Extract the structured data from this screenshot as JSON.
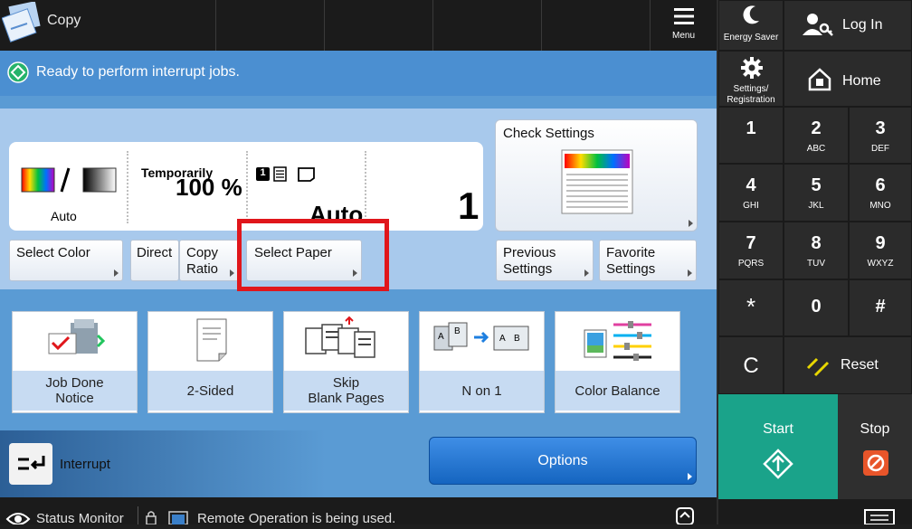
{
  "app": {
    "title": "Copy"
  },
  "header": {
    "menu_label": "Menu"
  },
  "status": {
    "message": "Ready to perform interrupt jobs."
  },
  "summary": {
    "color_mode": "Auto",
    "ratio_label": "Temporarily",
    "ratio_value": "100 %",
    "paper_value": "Auto",
    "copies": "1",
    "paper_indicator": "1"
  },
  "buttons": {
    "check_settings": "Check Settings",
    "select_color": "Select Color",
    "direct": "Direct",
    "copy_ratio_line1": "Copy",
    "copy_ratio_line2": "Ratio",
    "select_paper": "Select Paper",
    "previous_line1": "Previous",
    "previous_line2": "Settings",
    "favorite_line1": "Favorite",
    "favorite_line2": "Settings",
    "options": "Options",
    "interrupt": "Interrupt"
  },
  "features": [
    {
      "line1": "Job Done",
      "line2": "Notice"
    },
    {
      "line1": "2-Sided",
      "line2": ""
    },
    {
      "line1": "Skip",
      "line2": "Blank Pages"
    },
    {
      "line1": "N on 1",
      "line2": ""
    },
    {
      "line1": "Color Balance",
      "line2": ""
    }
  ],
  "right_panel": {
    "energy_saver": "Energy Saver",
    "log_in": "Log In",
    "settings_line1": "Settings/",
    "settings_line2": "Registration",
    "home": "Home",
    "reset": "Reset",
    "start": "Start",
    "stop": "Stop",
    "clear": "C",
    "keys": [
      {
        "n": "1",
        "l": ""
      },
      {
        "n": "2",
        "l": "ABC"
      },
      {
        "n": "3",
        "l": "DEF"
      },
      {
        "n": "4",
        "l": "GHI"
      },
      {
        "n": "5",
        "l": "JKL"
      },
      {
        "n": "6",
        "l": "MNO"
      },
      {
        "n": "7",
        "l": "PQRS"
      },
      {
        "n": "8",
        "l": "TUV"
      },
      {
        "n": "9",
        "l": "WXYZ"
      },
      {
        "n": "*",
        "l": ""
      },
      {
        "n": "0",
        "l": ""
      },
      {
        "n": "#",
        "l": ""
      }
    ]
  },
  "bottom": {
    "status_monitor": "Status Monitor",
    "remote_operation": "Remote Operation is being used."
  },
  "colors": {
    "accent_blue": "#5a9bd4",
    "start_green": "#1aa38a",
    "stop_orange": "#e8552a",
    "highlight_red": "#e0161b"
  },
  "icons": [
    "copy-app-icon",
    "menu-icon",
    "moon-icon",
    "user-key-icon",
    "gear-icon",
    "home-icon",
    "ok-icon",
    "reset-icon",
    "start-icon",
    "stop-icon",
    "interrupt-icon",
    "status-monitor-icon",
    "lock-icon",
    "monitor-icon",
    "remote-icon",
    "keypad-icon"
  ]
}
